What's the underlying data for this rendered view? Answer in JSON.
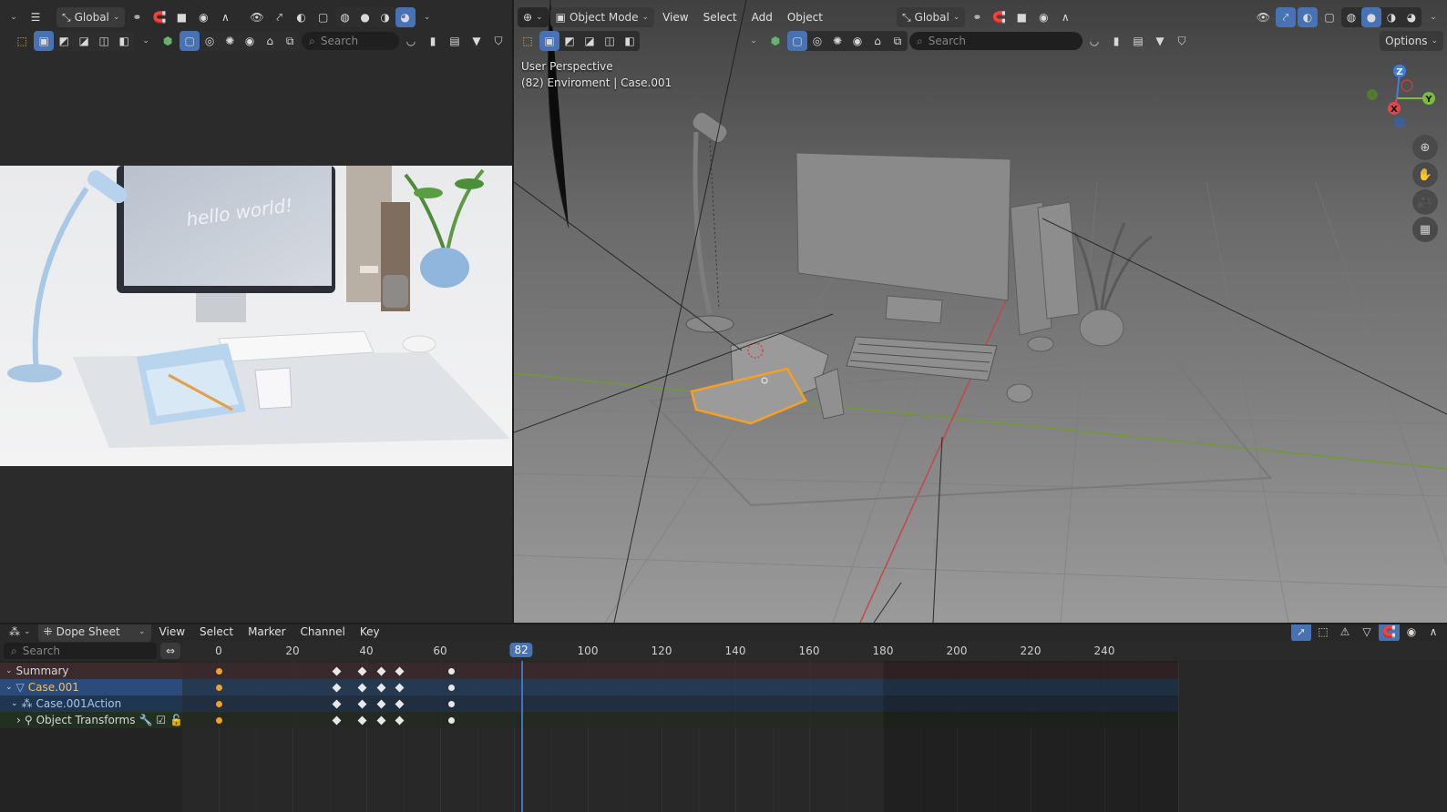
{
  "left_header": {
    "orientation": "Global",
    "search_placeholder": "Search"
  },
  "viewport": {
    "mode": "Object Mode",
    "menus": [
      "View",
      "Select",
      "Add",
      "Object"
    ],
    "orientation": "Global",
    "search_placeholder": "Search",
    "options_label": "Options",
    "overlay_view": "User Perspective",
    "overlay_object": "(82) Enviroment | Case.001",
    "gizmo": {
      "z": "Z",
      "y": "Y",
      "x": "X"
    }
  },
  "render_preview": {
    "screen_text": "hello world!"
  },
  "dopesheet": {
    "editor": "Dope Sheet",
    "menus": [
      "View",
      "Select",
      "Marker",
      "Channel",
      "Key"
    ],
    "search_placeholder": "Search",
    "current_frame": "82",
    "ruler_ticks": [
      "0",
      "20",
      "40",
      "60",
      "100",
      "120",
      "140",
      "160",
      "180",
      "200",
      "220",
      "240"
    ],
    "channels": [
      {
        "label": "Summary"
      },
      {
        "label": "Case.001"
      },
      {
        "label": "Case.001Action"
      },
      {
        "label": "Object Transforms"
      }
    ],
    "keyframes": [
      0,
      32,
      39,
      44,
      49,
      63
    ]
  },
  "colors": {
    "accent": "#4772b3",
    "selection_orange": "#f5a023",
    "x_axis": "#c33a3a",
    "y_axis": "#6a9a2c"
  }
}
